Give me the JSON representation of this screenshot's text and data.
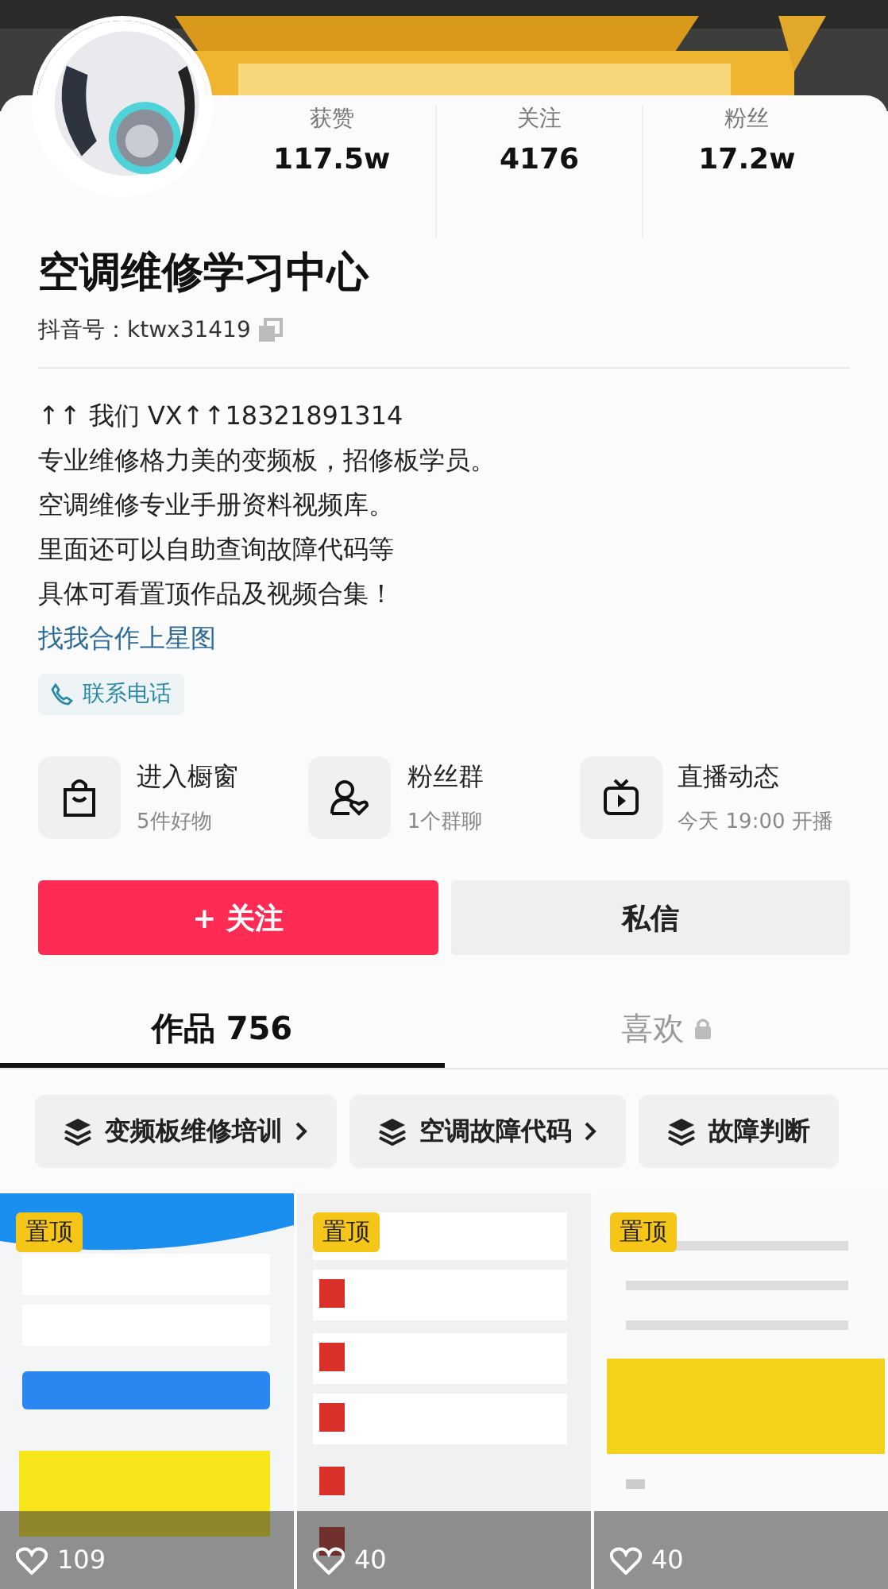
{
  "profile": {
    "name": "空调维修学习中心",
    "id_label": "抖音号：",
    "id_value": "ktwx31419"
  },
  "stats": [
    {
      "label": "获赞",
      "value": "117.5w"
    },
    {
      "label": "关注",
      "value": "4176"
    },
    {
      "label": "粉丝",
      "value": "17.2w"
    }
  ],
  "bio": [
    "↑↑ 我们 VX↑↑18321891314",
    "专业维修格力美的变频板，招修板学员。",
    "空调维修专业手册资料视频库。",
    "里面还可以自助查询故障代码等",
    "具体可看置顶作品及视频合集！"
  ],
  "link": "找我合作上星图",
  "contact_chip": "联系电话",
  "features": [
    {
      "kind": "shop",
      "title": "进入橱窗",
      "subtitle": "5件好物"
    },
    {
      "kind": "fans",
      "title": "粉丝群",
      "subtitle": "1个群聊"
    },
    {
      "kind": "live",
      "title": "直播动态",
      "subtitle": "今天 19:00 开播"
    }
  ],
  "actions": [
    {
      "kind": "primary",
      "label": "+ 关注"
    },
    {
      "kind": "secondary",
      "label": "私信"
    }
  ],
  "tabs": [
    {
      "label": "作品 756",
      "selected": true,
      "locked": false
    },
    {
      "label": "喜欢",
      "selected": false,
      "locked": true
    }
  ],
  "collections": [
    "变频板维修培训",
    "空调故障代码",
    "故障判断"
  ],
  "videos": [
    {
      "pinned": true,
      "pin_label": "置顶",
      "likes": "109"
    },
    {
      "pinned": true,
      "pin_label": "置顶",
      "likes": "40"
    },
    {
      "pinned": true,
      "pin_label": "置顶",
      "likes": "40"
    }
  ]
}
